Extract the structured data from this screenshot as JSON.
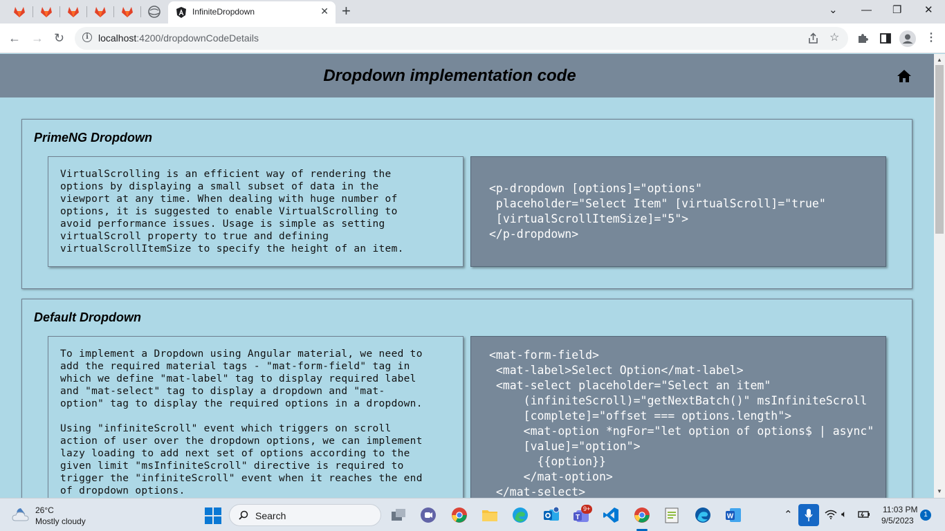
{
  "browser": {
    "active_tab_title": "InfiniteDropdown",
    "new_tab_symbol": "+",
    "url_host": "localhost",
    "url_rest": ":4200/dropdownCodeDetails"
  },
  "page": {
    "title": "Dropdown implementation code",
    "sections": [
      {
        "heading": "PrimeNG Dropdown",
        "description": "VirtualScrolling is an efficient way of rendering the\noptions by displaying a small subset of data in the\nviewport at any time. When dealing with huge number of\noptions, it is suggested to enable VirtualScrolling to\navoid performance issues. Usage is simple as setting\nvirtualScroll property to true and defining\nvirtualScrollItemSize to specify the height of an item.",
        "code": "<p-dropdown [options]=\"options\"\n placeholder=\"Select Item\" [virtualScroll]=\"true\"\n [virtualScrollItemSize]=\"5\">\n</p-dropdown>"
      },
      {
        "heading": "Default Dropdown",
        "description": "To implement a Dropdown using Angular material, we need to\nadd the required material tags - \"mat-form-field\" tag in\nwhich we define \"mat-label\" tag to display required label\nand \"mat-select\" tag to display a dropdown and \"mat-\noption\" tag to display the required options in a dropdown.\n\nUsing \"infiniteScroll\" event which triggers on scroll\naction of user over the dropdown options, we can implement\nlazy loading to add next set of options according to the\ngiven limit \"msInfiniteScroll\" directive is required to\ntrigger the \"infiniteScroll\" event when it reaches the end\nof dropdown options.",
        "code": "<mat-form-field>\n <mat-label>Select Option</mat-label>\n <mat-select placeholder=\"Select an item\"\n     (infiniteScroll)=\"getNextBatch()\" msInfiniteScroll\n     [complete]=\"offset === options.length\">\n     <mat-option *ngFor=\"let option of options$ | async\"\n     [value]=\"option\">\n       {{option}}\n     </mat-option>\n </mat-select>"
      }
    ]
  },
  "taskbar": {
    "temperature": "26°C",
    "weather": "Mostly cloudy",
    "search_label": "Search",
    "teams_badge": "9+",
    "time": "11:03 PM",
    "date": "9/5/2023",
    "notification_count": "1"
  }
}
